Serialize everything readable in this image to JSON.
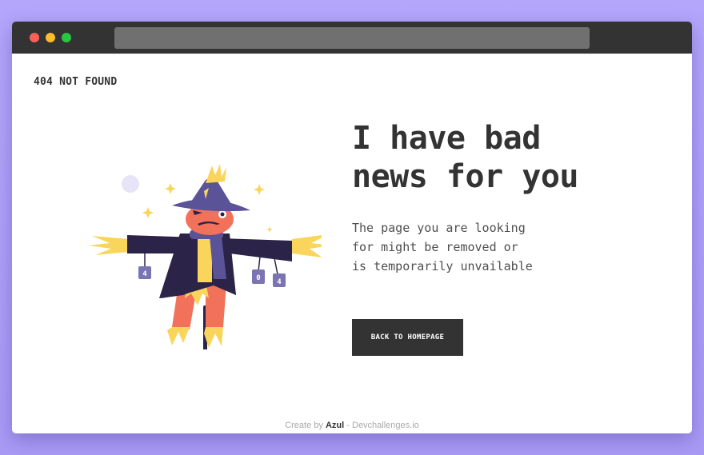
{
  "window": {
    "controls": [
      "close",
      "minimize",
      "zoom"
    ],
    "address_bar": ""
  },
  "brand": "404 NOT FOUND",
  "illustration": {
    "name": "scarecrow-404",
    "can_labels": [
      "4",
      "0",
      "4"
    ]
  },
  "headline": {
    "line1": "I have bad",
    "line2": "news for you"
  },
  "message": {
    "line1": "The page you are looking",
    "line2": "for might be removed or",
    "line3": "is temporarily unvailable"
  },
  "button": {
    "label": "BACK TO HOMEPAGE"
  },
  "footer": {
    "prefix": "Create by",
    "author": "Azul",
    "separator": "-",
    "site": "Devchallenges.io"
  },
  "colors": {
    "background": "#b4a6fb",
    "titlebar": "#333333",
    "text": "#333333",
    "button": "#333333",
    "scarecrow_coat": "#2b2448",
    "scarecrow_hat": "#5a5397",
    "scarecrow_face": "#f2715a",
    "straw": "#f9d65b"
  }
}
